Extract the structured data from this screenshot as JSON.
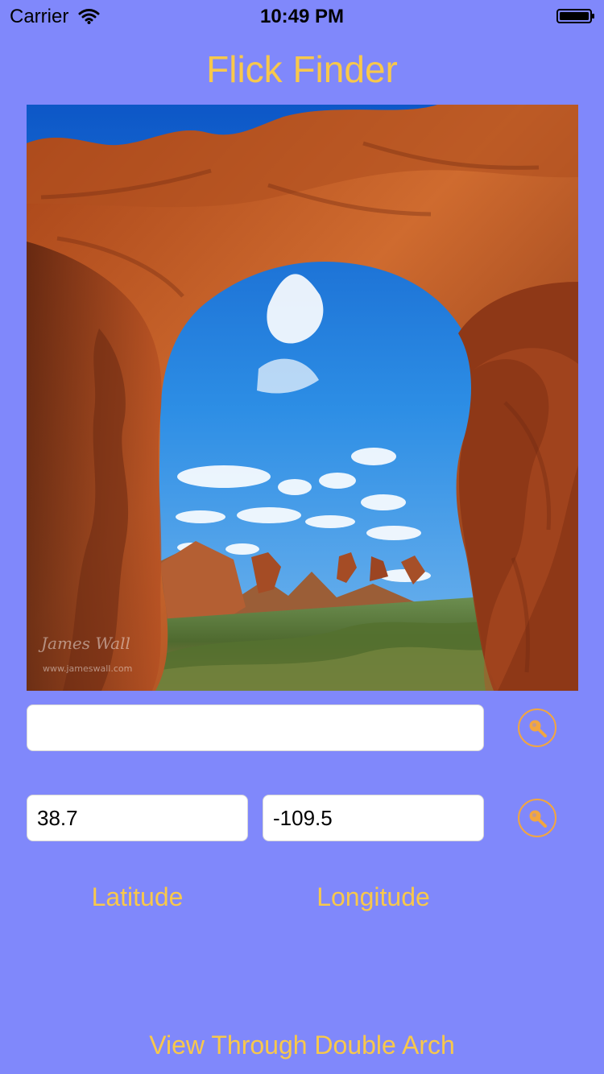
{
  "status_bar": {
    "carrier": "Carrier",
    "time": "10:49 PM",
    "icons": [
      "wifi-icon",
      "battery-icon"
    ]
  },
  "app": {
    "title": "Flick Finder"
  },
  "photo": {
    "alt": "View Through Double Arch"
  },
  "search": {
    "phrase_value": "",
    "phrase_placeholder": "",
    "latitude_value": "38.7",
    "longitude_value": "-109.5",
    "phrase_button_icon": "search-icon",
    "geo_button_icon": "search-icon"
  },
  "labels": {
    "latitude": "Latitude",
    "longitude": "Longitude"
  },
  "photo_title": "View Through Double Arch",
  "colors": {
    "background": "#8088fb",
    "accent": "#f8c84b",
    "search_button_accent": "#f2a640"
  }
}
